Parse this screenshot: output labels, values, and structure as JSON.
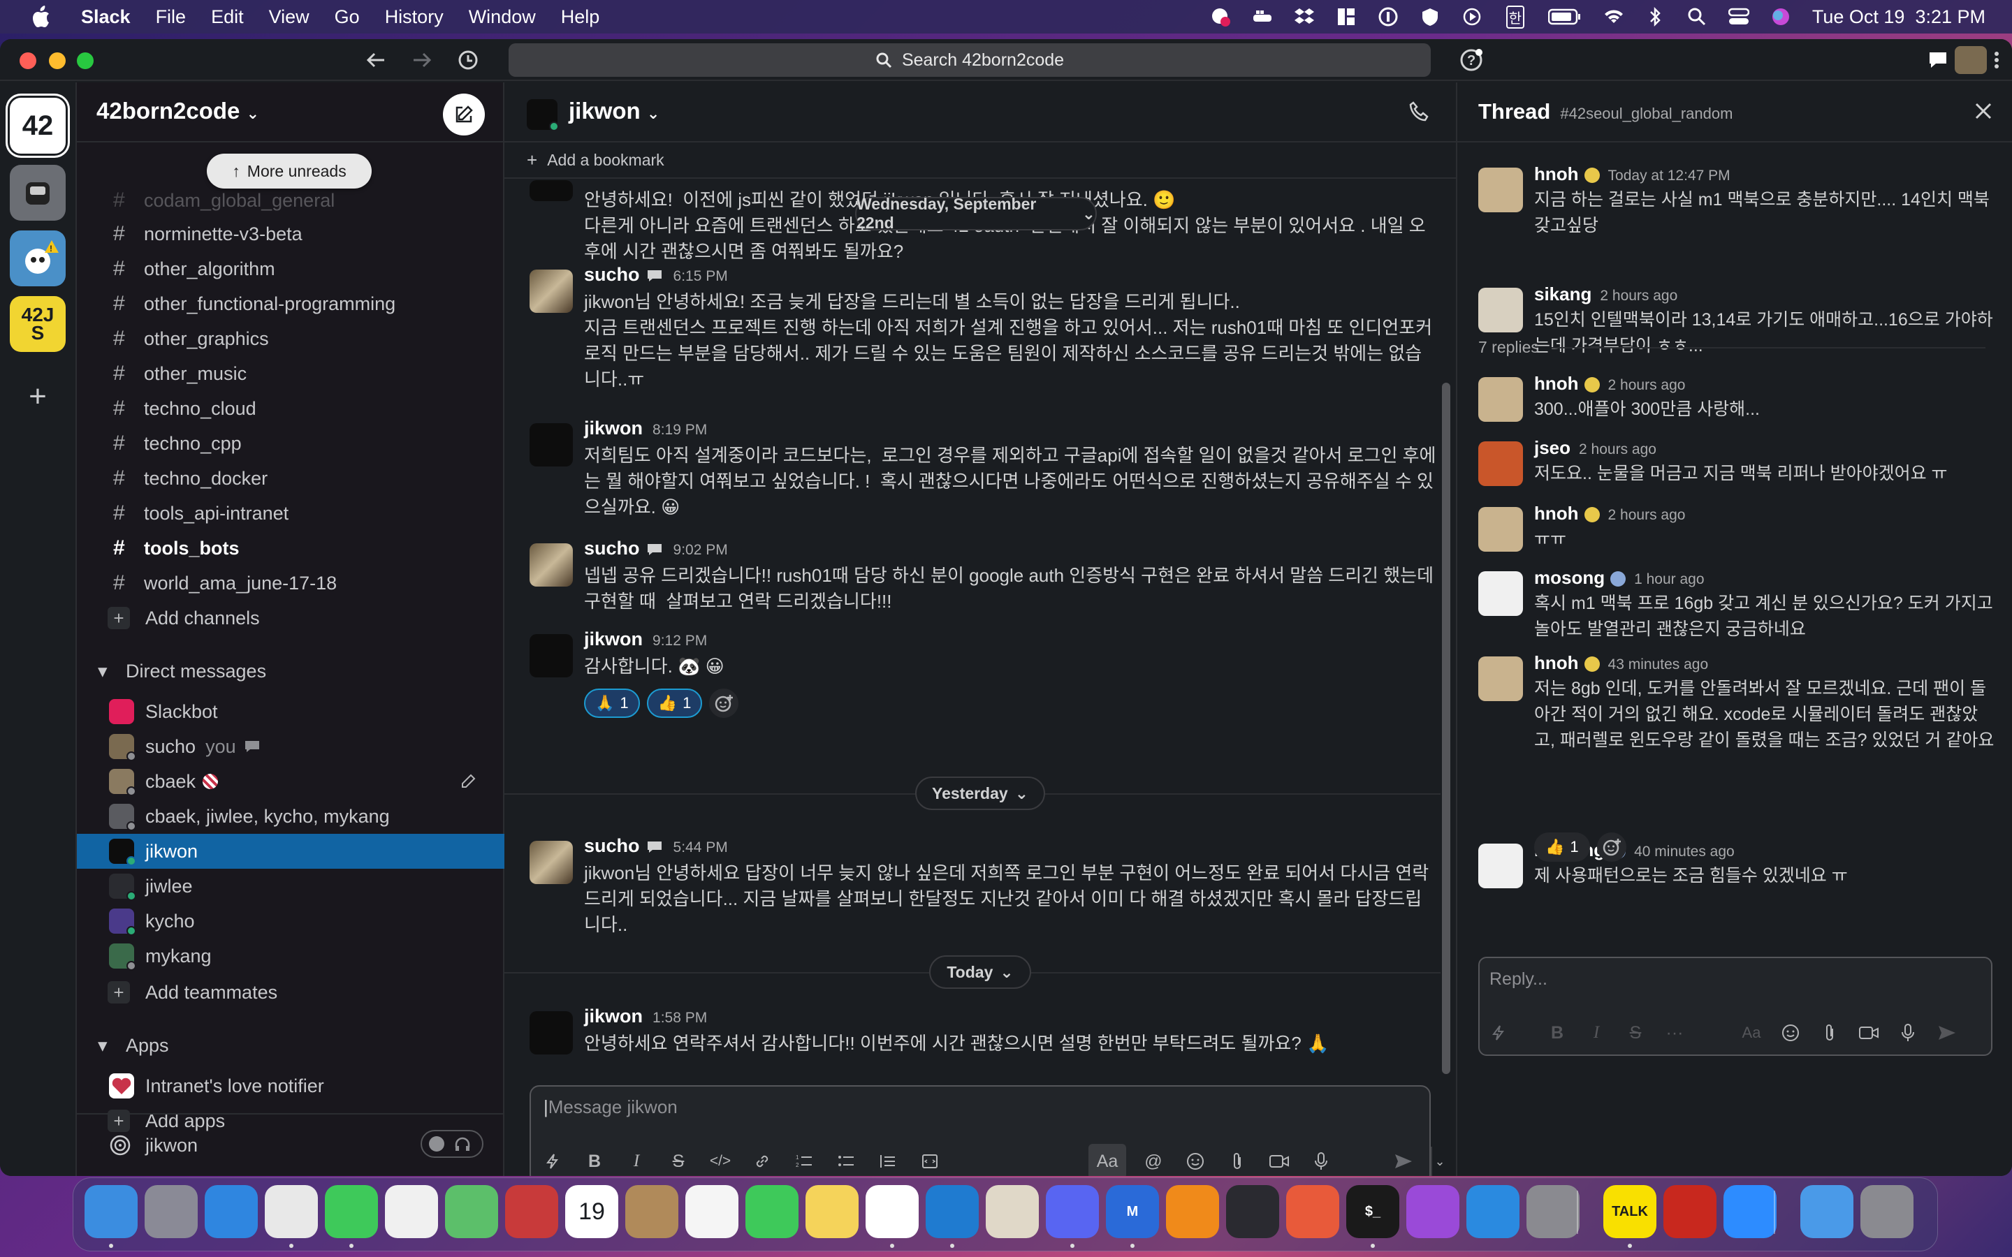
{
  "menubar": {
    "app": "Slack",
    "items": [
      "File",
      "Edit",
      "View",
      "Go",
      "History",
      "Window",
      "Help"
    ],
    "clock": "Tue Oct 19  3:21 PM",
    "ime": "한"
  },
  "search": {
    "placeholder": "Search 42born2code"
  },
  "workspaces": [
    {
      "label": "42",
      "color": "#ffffff"
    },
    {
      "label": "",
      "color": "#6b6e74"
    },
    {
      "label": "",
      "color": "#4a90c8"
    },
    {
      "label": "42JS",
      "color": "#f1d531"
    }
  ],
  "sidebar": {
    "workspace": "42born2code",
    "more_unreads": "More unreads",
    "channels": [
      {
        "name": "codam_global_general",
        "bold": false
      },
      {
        "name": "norminette-v3-beta",
        "bold": false
      },
      {
        "name": "other_algorithm",
        "bold": false
      },
      {
        "name": "other_functional-programming",
        "bold": false
      },
      {
        "name": "other_graphics",
        "bold": false
      },
      {
        "name": "other_music",
        "bold": false
      },
      {
        "name": "techno_cloud",
        "bold": false
      },
      {
        "name": "techno_cpp",
        "bold": false
      },
      {
        "name": "techno_docker",
        "bold": false
      },
      {
        "name": "tools_api-intranet",
        "bold": false
      },
      {
        "name": "tools_bots",
        "bold": true
      },
      {
        "name": "world_ama_june-17-18",
        "bold": false
      }
    ],
    "add_channels": "Add channels",
    "dm_header": "Direct messages",
    "dms": [
      {
        "name": "Slackbot",
        "sub": "",
        "color": "#e01e5a"
      },
      {
        "name": "sucho",
        "sub": "you",
        "color": "#7a6a50"
      },
      {
        "name": "cbaek",
        "sub": "",
        "color": "#8a7a60"
      },
      {
        "name": "cbaek, jiwlee, kycho, mykang",
        "sub": "",
        "color": "#5a5b60"
      },
      {
        "name": "jikwon",
        "sub": "",
        "color": "#0d0d0d",
        "active": true
      },
      {
        "name": "jiwlee",
        "sub": "",
        "color": "#2a2b30"
      },
      {
        "name": "kycho",
        "sub": "",
        "color": "#4a3a8a"
      },
      {
        "name": "mykang",
        "sub": "",
        "color": "#3a6a4a"
      }
    ],
    "add_teammates": "Add teammates",
    "apps_header": "Apps",
    "apps": [
      {
        "name": "Intranet's love notifier",
        "color": "#c8334a"
      }
    ],
    "add_apps": "Add apps",
    "footer_user": "jikwon"
  },
  "channel": {
    "name": "jikwon",
    "bookmark": "Add a bookmark",
    "date_pills": [
      "Wednesday, September 22nd",
      "Yesterday",
      "Today"
    ],
    "messages": [
      {
        "author": "",
        "time": "",
        "text": "안녕하세요!  이전에 js피씬 같이 했었던 jikwon 입니다. 혹시 잘 지내셨나요. 🙂\n다른게 아니라 요즘에 트랜센던스 하고 있는데요 42 oauth  관련해서 잘 이해되지 않는 부분이 있어서요 . 내일 오후에 시간 괜찮으시면 좀 여쭤봐도 될까요?"
      },
      {
        "author": "sucho",
        "time": "6:15 PM",
        "text": "jikwon님 안녕하세요! 조금 늦게 답장을 드리는데 별 소득이 없는 답장을 드리게 됩니다..\n지금 트랜센던스 프로젝트 진행 하는데 아직 저희가 설계 진행을 하고 있어서... 저는 rush01때 마침 또 인디언포커 로직 만드는 부분을 담당해서.. 제가 드릴 수 있는 도움은 팀원이 제작하신 소스코드를 공유 드리는것 밖에는 없습니다..ㅠ"
      },
      {
        "author": "jikwon",
        "time": "8:19 PM",
        "text": "저희팀도 아직 설계중이라 코드보다는,  로그인 경우를 제외하고 구글api에 접속할 일이 없을것 같아서 로그인 후에는 뭘 해야할지 여쭤보고 싶었습니다. !  혹시 괜찮으시다면 나중에라도 어떤식으로 진행하셨는지 공유해주실 수 있으실까요. 😀"
      },
      {
        "author": "sucho",
        "time": "9:02 PM",
        "text": "넵넵 공유 드리겠습니다!! rush01때 담당 하신 분이 google auth 인증방식 구현은 완료 하셔서 말씀 드리긴 했는데 구현할 때  살펴보고 연락 드리겠습니다!!!"
      },
      {
        "author": "jikwon",
        "time": "9:12 PM",
        "text": "감사합니다. 🐼 😀"
      },
      {
        "author": "sucho",
        "time": "5:44 PM",
        "text": "jikwon님 안녕하세요 답장이 너무 늦지 않나 싶은데 저희쪽 로그인 부분 구현이 어느정도 완료 되어서 다시금 연락드리게 되었습니다... 지금 날짜를 살펴보니 한달정도 지난것 같아서 이미 다 해결 하셨겠지만 혹시 몰라 답장드립니다.."
      },
      {
        "author": "jikwon",
        "time": "1:58 PM",
        "text": "안녕하세요 연락주셔서 감사합니다!!  이번주에 시간 괜찮으시면 설명 한번만 부탁드려도 될까요? 🙏"
      }
    ],
    "reactions": [
      {
        "emoji": "🙏",
        "count": "1"
      },
      {
        "emoji": "👍",
        "count": "1"
      }
    ],
    "composer_placeholder": "Message jikwon"
  },
  "thread": {
    "title": "Thread",
    "channel": "#42seoul_global_random",
    "reply_count": "7 replies",
    "messages": [
      {
        "author": "hnoh",
        "time": "Today at 12:47 PM",
        "badge": "#e8c84a",
        "avatar": "#c9b38e",
        "text": "지금 하는 걸로는 사실 m1 맥북으로 충분하지만.... 14인치 맥북 갖고싶당"
      },
      {
        "author": "sikang",
        "time": "2 hours ago",
        "badge": "",
        "avatar": "#d8d0c0",
        "text": "15인치 인텔맥북이라 13,14로 가기도 애매하고...16으로 가야하는데 가격부담이 ㅎㅎ..."
      },
      {
        "author": "hnoh",
        "time": "2 hours ago",
        "badge": "#e8c84a",
        "avatar": "#c9b38e",
        "text": "300...애플아 300만큼 사랑해..."
      },
      {
        "author": "jseo",
        "time": "2 hours ago",
        "badge": "",
        "avatar": "#c9562a",
        "text": "저도요.. 눈물을 머금고 지금 맥북 리퍼나 받아야겠어요 ㅠ"
      },
      {
        "author": "hnoh",
        "time": "2 hours ago",
        "badge": "#e8c84a",
        "avatar": "#c9b38e",
        "text": "ㅠㅠ"
      },
      {
        "author": "mosong",
        "time": "1 hour ago",
        "badge": "#8aa8d8",
        "avatar": "#f0f0f0",
        "text": "혹시 m1 맥북 프로 16gb 갖고 계신 분 있으신가요? 도커 가지고 놀아도 발열관리 괜찮은지 궁금하네요"
      },
      {
        "author": "hnoh",
        "time": "43 minutes ago",
        "badge": "#e8c84a",
        "avatar": "#c9b38e",
        "text": "저는 8gb 인데, 도커를 안돌려봐서 잘 모르겠네요. 근데 팬이 돌아간 적이 거의 없긴 해요. xcode로 시뮬레이터 돌려도 괜찮았고, 패러렐로 윈도우랑 같이 돌렸을 때는 조금? 있었던 거 같아요"
      },
      {
        "author": "mosong",
        "time": "40 minutes ago",
        "badge": "#8aa8d8",
        "avatar": "#f0f0f0",
        "text": "제 사용패턴으로는 조금 힘들수 있겠네요 ㅠ"
      }
    ],
    "reactions": [
      {
        "emoji": "👍",
        "count": "1"
      }
    ],
    "composer_placeholder": "Reply..."
  },
  "dock": {
    "apps": [
      {
        "name": "Finder",
        "color": "#3b8de0",
        "label": "",
        "running": true
      },
      {
        "name": "Launchpad",
        "color": "#8a8a96",
        "label": "",
        "running": false
      },
      {
        "name": "Safari",
        "color": "#2f86e0",
        "label": "",
        "running": false
      },
      {
        "name": "Chrome",
        "color": "#e8e8e8",
        "label": "",
        "running": true
      },
      {
        "name": "Messages",
        "color": "#3ec95a",
        "label": "",
        "running": true
      },
      {
        "name": "Photos",
        "color": "#f0f0f0",
        "label": "",
        "running": false
      },
      {
        "name": "Maps",
        "color": "#5cbf6a",
        "label": "",
        "running": false
      },
      {
        "name": "Photo Booth",
        "color": "#c83a3a",
        "label": "",
        "running": false
      },
      {
        "name": "Calendar",
        "color": "#ffffff",
        "label": "19",
        "running": false
      },
      {
        "name": "Contacts",
        "color": "#b08a5a",
        "label": "",
        "running": false
      },
      {
        "name": "Reminders",
        "color": "#f5f5f5",
        "label": "",
        "running": false
      },
      {
        "name": "FaceTime",
        "color": "#3ec95a",
        "label": "",
        "running": false
      },
      {
        "name": "Notes",
        "color": "#f5d35a",
        "label": "",
        "running": false
      },
      {
        "name": "Slack",
        "color": "#ffffff",
        "label": "",
        "running": true
      },
      {
        "name": "VS Code",
        "color": "#1f7bd0",
        "label": "",
        "running": true
      },
      {
        "name": "Ghidra",
        "color": "#e0d8c8",
        "label": "",
        "running": false
      },
      {
        "name": "Discord",
        "color": "#5865f2",
        "label": "",
        "running": true
      },
      {
        "name": "Notion",
        "color": "#2a6ad8",
        "label": "M",
        "running": true
      },
      {
        "name": "VLC",
        "color": "#f08a1a",
        "label": "",
        "running": false
      },
      {
        "name": "Network",
        "color": "#2a2a30",
        "label": "",
        "running": false
      },
      {
        "name": "Pencil",
        "color": "#e85a3a",
        "label": "",
        "running": false
      },
      {
        "name": "Terminal",
        "color": "#1a1a1a",
        "label": "$_",
        "running": true
      },
      {
        "name": "Podcasts",
        "color": "#9a4ad8",
        "label": "",
        "running": false
      },
      {
        "name": "App Store",
        "color": "#2a8ae0",
        "label": "",
        "running": false
      },
      {
        "name": "System Preferences",
        "color": "#8a8a90",
        "label": "",
        "running": false
      },
      {
        "name": "KakaoTalk",
        "color": "#f9e000",
        "label": "TALK",
        "running": true
      },
      {
        "name": "Acrobat",
        "color": "#c8281e",
        "label": "",
        "running": false
      },
      {
        "name": "Zoom",
        "color": "#2d8cff",
        "label": "",
        "running": false
      },
      {
        "name": "Downloads",
        "color": "#4a9ae8",
        "label": "",
        "running": false
      },
      {
        "name": "Trash",
        "color": "#8a8a90",
        "label": "",
        "running": false
      }
    ]
  }
}
